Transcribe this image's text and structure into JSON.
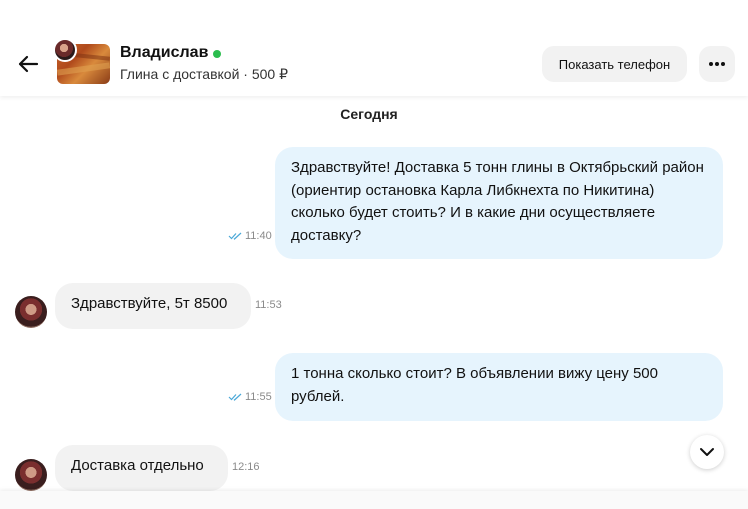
{
  "header": {
    "seller_name": "Владислав",
    "listing": "Глина с доставкой · 500 ₽",
    "phone_button": "Показать телефон"
  },
  "day_label": "Сегодня",
  "messages": [
    {
      "direction": "out",
      "text": "Здравствуйте! Доставка 5 тонн глины в Октябрьский район (ориентир остановка Карла Либкнехта по Никитина) сколько будет стоить? И в какие дни осуществляете доставку?",
      "time": "11:40",
      "read": true
    },
    {
      "direction": "in",
      "text": "Здравствуйте, 5т 8500",
      "time": "11:53"
    },
    {
      "direction": "out",
      "text": "1 тонна сколько стоит? В объявлении вижу цену 500 рублей.",
      "time": "11:55",
      "read": true
    },
    {
      "direction": "in",
      "text": "Доставка отдельно",
      "time": "12:16"
    }
  ],
  "colors": {
    "online": "#2bbd4e",
    "outgoing_bubble": "#e6f4fd",
    "incoming_bubble": "#f2f2f2",
    "read_check": "#4aa8d8"
  },
  "icons": [
    "back-arrow-icon",
    "more-dots-icon",
    "read-check-icon",
    "chevron-down-icon"
  ]
}
